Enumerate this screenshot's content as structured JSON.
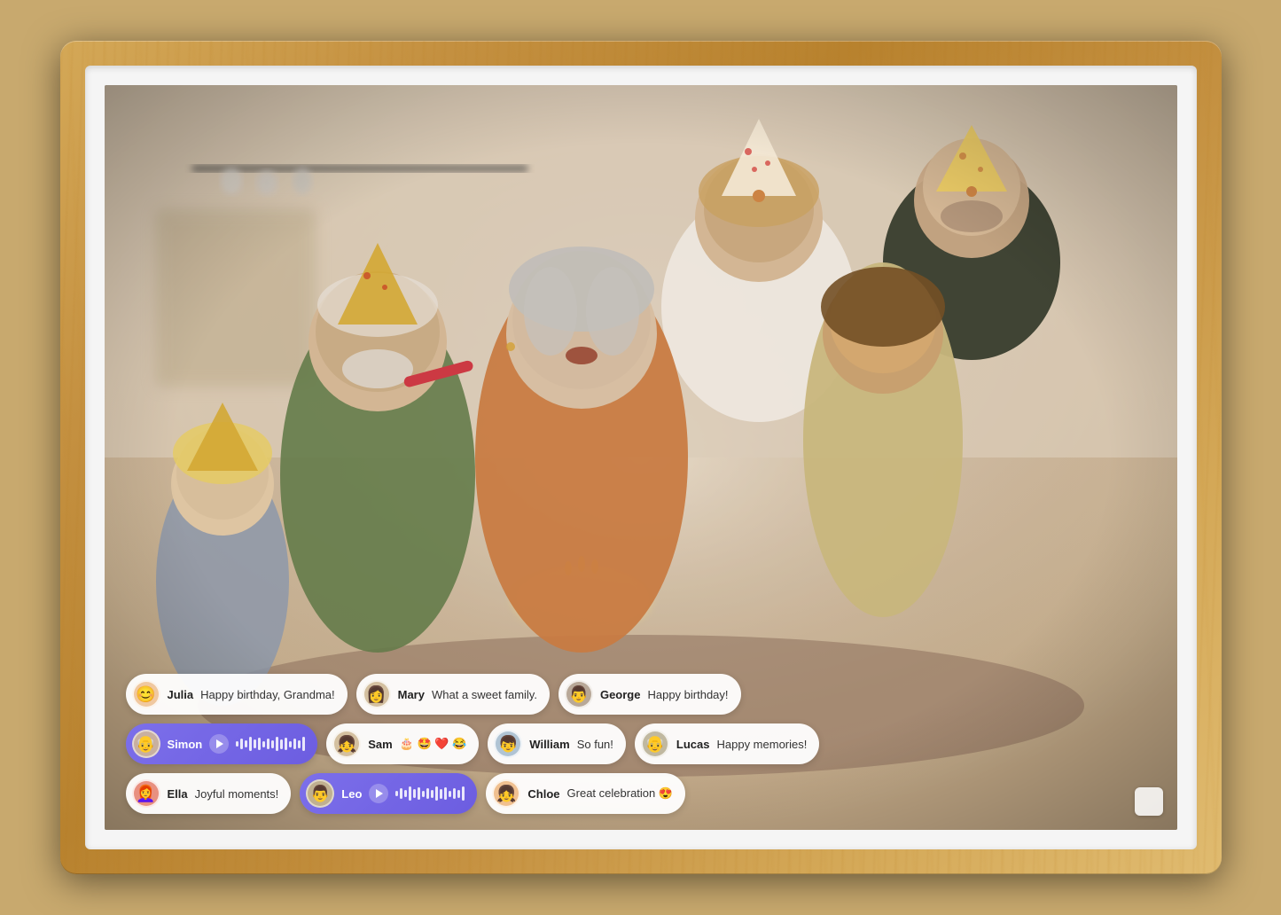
{
  "frame": {
    "background_color": "#c8a560"
  },
  "comments": {
    "row1": [
      {
        "id": "julia",
        "name": "Julia",
        "text": "Happy birthday, Grandma!",
        "type": "text",
        "avatar_emoji": "😊",
        "avatar_bg": "#f0c8a0"
      },
      {
        "id": "mary",
        "name": "Mary",
        "text": "What a sweet family.",
        "type": "text",
        "avatar_emoji": "👩",
        "avatar_bg": "#d4b090"
      },
      {
        "id": "george",
        "name": "George",
        "text": "Happy birthday!",
        "type": "text",
        "avatar_emoji": "👨",
        "avatar_bg": "#b8a090"
      }
    ],
    "row2": [
      {
        "id": "simon",
        "name": "Simon",
        "text": "",
        "type": "voice",
        "avatar_emoji": "👴",
        "avatar_bg": "#c8b0a0"
      },
      {
        "id": "sam",
        "name": "Sam",
        "text": "🎂 🤩 ❤️ 😂",
        "type": "text",
        "avatar_emoji": "👧",
        "avatar_bg": "#d4c0a0"
      },
      {
        "id": "william",
        "name": "William",
        "text": "So fun!",
        "type": "text",
        "avatar_emoji": "👦",
        "avatar_bg": "#b0c4d4"
      },
      {
        "id": "lucas",
        "name": "Lucas",
        "text": "Happy memories!",
        "type": "text",
        "avatar_emoji": "👴",
        "avatar_bg": "#c0b8a0"
      }
    ],
    "row3": [
      {
        "id": "ella",
        "name": "Ella",
        "text": "Joyful moments!",
        "type": "text",
        "avatar_emoji": "👩‍🦰",
        "avatar_bg": "#e8a090"
      },
      {
        "id": "leo",
        "name": "Leo",
        "text": "",
        "type": "voice",
        "avatar_emoji": "👨",
        "avatar_bg": "#c0b090"
      },
      {
        "id": "chloe",
        "name": "Chloe",
        "text": "Great celebration 😍",
        "type": "text",
        "avatar_emoji": "👧",
        "avatar_bg": "#f0c090"
      }
    ]
  },
  "wave_bars_heights": [
    8,
    14,
    10,
    18,
    12,
    16,
    8,
    14,
    10,
    18,
    12,
    16,
    8,
    14,
    10,
    18
  ],
  "corner_button_label": ""
}
